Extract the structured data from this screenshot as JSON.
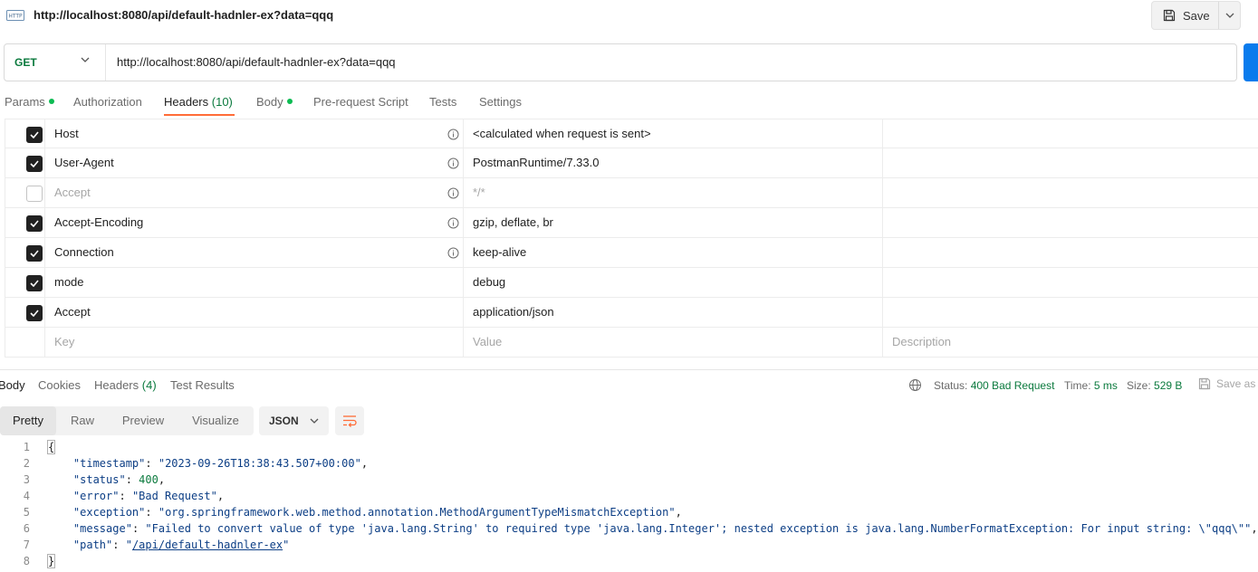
{
  "title_bar": {
    "icon_name": "http-icon",
    "icon_text": "HTTP",
    "title": "http://localhost:8080/api/default-hadnler-ex?data=qqq",
    "save_label": "Save"
  },
  "url_bar": {
    "method": "GET",
    "url": "http://localhost:8080/api/default-hadnler-ex?data=qqq"
  },
  "request_tabs": {
    "params": "Params",
    "authorization": "Authorization",
    "headers": "Headers",
    "headers_count": "(10)",
    "body": "Body",
    "pre_request": "Pre-request Script",
    "tests": "Tests",
    "settings": "Settings"
  },
  "headers_table": {
    "rows": [
      {
        "key": "Host",
        "value": "<calculated when request is sent>",
        "checked": true
      },
      {
        "key": "User-Agent",
        "value": "PostmanRuntime/7.33.0",
        "checked": true
      },
      {
        "key": "Accept",
        "value": "*/*",
        "checked": false
      },
      {
        "key": "Accept-Encoding",
        "value": "gzip, deflate, br",
        "checked": true
      },
      {
        "key": "Connection",
        "value": "keep-alive",
        "checked": true
      },
      {
        "key": "mode",
        "value": "debug",
        "checked": true
      },
      {
        "key": "Accept",
        "value": "application/json",
        "checked": true
      }
    ],
    "placeholder_key": "Key",
    "placeholder_value": "Value",
    "placeholder_description": "Description"
  },
  "response": {
    "tabs": {
      "body": "Body",
      "cookies": "Cookies",
      "headers": "Headers",
      "headers_count": "(4)",
      "test_results": "Test Results"
    },
    "status_label": "Status:",
    "status_value": "400 Bad Request",
    "time_label": "Time:",
    "time_value": "5 ms",
    "size_label": "Size:",
    "size_value": "529 B",
    "save_as": "Save as",
    "views": {
      "pretty": "Pretty",
      "raw": "Raw",
      "preview": "Preview",
      "visualize": "Visualize"
    },
    "format": "JSON",
    "line_numbers": [
      "1",
      "2",
      "3",
      "4",
      "5",
      "6",
      "7",
      "8"
    ],
    "json": {
      "open": "{",
      "close": "}",
      "timestamp_key": "\"timestamp\"",
      "timestamp_val": "\"2023-09-26T18:38:43.507+00:00\"",
      "status_key": "\"status\"",
      "status_val": "400",
      "error_key": "\"error\"",
      "error_val": "\"Bad Request\"",
      "exception_key": "\"exception\"",
      "exception_val": "\"org.springframework.web.method.annotation.MethodArgumentTypeMismatchException\"",
      "message_key": "\"message\"",
      "message_val": "\"Failed to convert value of type 'java.lang.String' to required type 'java.lang.Integer'; nested exception is java.lang.NumberFormatException: For input string: \\\"qqq\\\"\"",
      "path_key": "\"path\"",
      "path_val_q1": "\"",
      "path_val": "/api/default-hadnler-ex",
      "path_val_q2": "\""
    }
  },
  "colors": {
    "accent": "#ff6c37",
    "send_blue": "#097bed",
    "method_green": "#0b7a3e",
    "status_green": "#0b7a3e"
  }
}
